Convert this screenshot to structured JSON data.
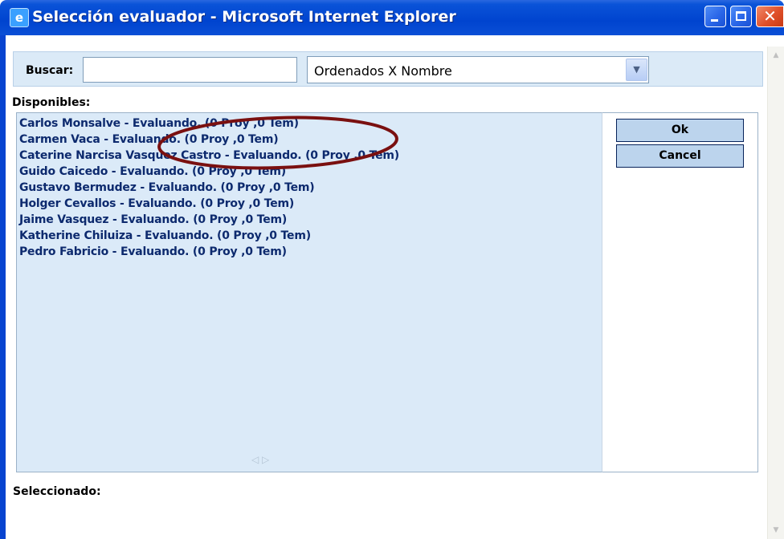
{
  "window": {
    "title": "Selección evaluador - Microsoft Internet Explorer"
  },
  "search": {
    "label": "Buscar:",
    "value": "",
    "sort_selected": "Ordenados X Nombre"
  },
  "available": {
    "label": "Disponibles:",
    "items": [
      "Carlos Monsalve - Evaluando. (0 Proy ,0 Tem)",
      "Carmen Vaca - Evaluando. (0 Proy ,0 Tem)",
      "Caterine Narcisa Vasquez Castro - Evaluando. (0 Proy ,0 Tem)",
      "Guido Caicedo - Evaluando. (0 Proy ,0 Tem)",
      "Gustavo Bermudez - Evaluando. (0 Proy ,0 Tem)",
      "Holger Cevallos - Evaluando. (0 Proy ,0 Tem)",
      "Jaime Vasquez - Evaluando. (0 Proy ,0 Tem)",
      "Katherine Chiluiza - Evaluando. (0 Proy ,0 Tem)",
      "Pedro Fabricio - Evaluando. (0 Proy ,0 Tem)"
    ]
  },
  "actions": {
    "ok": "Ok",
    "cancel": "Cancel"
  },
  "selected": {
    "label": "Seleccionado:"
  },
  "colors": {
    "titlebar": "#0a53d8",
    "list_background": "#dbeaf8",
    "item_text": "#0d2a6e",
    "annotation": "#7a1010"
  },
  "icons": {
    "window": "ie-page-icon",
    "minimize": "minimize-icon",
    "maximize": "maximize-icon",
    "close": "close-icon",
    "dropdown": "chevron-down-icon"
  }
}
